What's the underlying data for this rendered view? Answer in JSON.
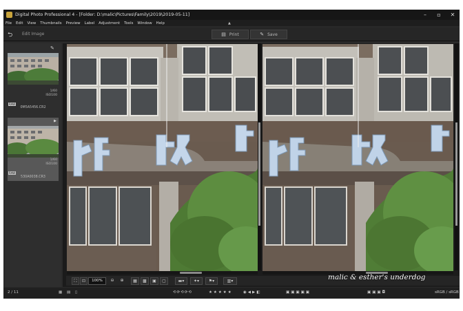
{
  "window": {
    "title": "Digital Photo Professional 4 - [Folder: D:\\malic\\Pictures\\Family\\2019\\2019-05-11]",
    "controls": [
      "minimize-icon",
      "restore-icon",
      "close-icon"
    ]
  },
  "menu": [
    "File",
    "Edit",
    "View",
    "Thumbnails",
    "Preview",
    "Label",
    "Adjustment",
    "Tools",
    "Window",
    "Help"
  ],
  "toolbar": {
    "edit_image": "Edit Image",
    "print": "Print",
    "save": "Save"
  },
  "thumbnails": [
    {
      "name": "0M5A5456.CR2",
      "shutter": "1/60",
      "iso": "ISO100",
      "badge": "RAW",
      "selected": false
    },
    {
      "name": "530A0038.CR3",
      "shutter": "1/60",
      "iso": "ISO100",
      "badge": "RAW",
      "selected": true
    }
  ],
  "viewer": {
    "zoom": "100%"
  },
  "status": {
    "page": "2 / 11",
    "color_space": "sRGB / sRGB"
  },
  "watermark": "malic & esther's underdog"
}
